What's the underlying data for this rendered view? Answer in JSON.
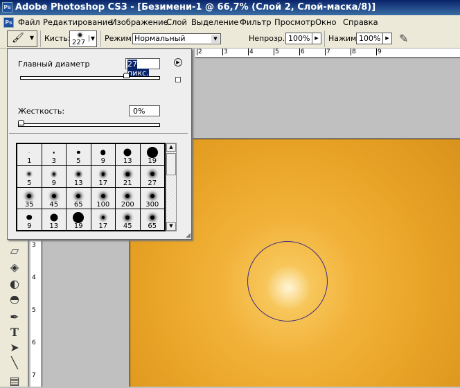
{
  "title": "Adobe Photoshop CS3 - [Безимени-1 @ 66,7% (Слой 2, Слой-маска/8)]",
  "menu": [
    "Файл",
    "Редактирование",
    "Изображение",
    "Слой",
    "Выделение",
    "Фильтр",
    "Просмотр",
    "Окно",
    "Справка"
  ],
  "options": {
    "brush_label": "Кисть:",
    "brush_size": "227",
    "mode_label": "Режим:",
    "mode_value": "Нормальный",
    "opacity_label": "Непрозр.:",
    "opacity_value": "100%",
    "flow_label": "Нажим:",
    "flow_value": "100%"
  },
  "ruler_top": [
    "2",
    "3",
    "4",
    "5",
    "6",
    "7",
    "8",
    "9"
  ],
  "ruler_left": [
    "3",
    "4",
    "5",
    "6",
    "7"
  ],
  "brush_panel": {
    "diameter_label": "Главный диаметр",
    "diameter_value": "27 пикс.",
    "diameter_fraction": 0.77,
    "hardness_label": "Жесткость:",
    "hardness_value": "0%",
    "hardness_fraction": 0,
    "presets": [
      {
        "size": "1",
        "hard": true
      },
      {
        "size": "3",
        "hard": true
      },
      {
        "size": "5",
        "hard": true
      },
      {
        "size": "9",
        "hard": true
      },
      {
        "size": "13",
        "hard": true
      },
      {
        "size": "19",
        "hard": true
      },
      {
        "size": "5",
        "hard": false
      },
      {
        "size": "9",
        "hard": false
      },
      {
        "size": "13",
        "hard": false
      },
      {
        "size": "17",
        "hard": false
      },
      {
        "size": "21",
        "hard": false
      },
      {
        "size": "27",
        "hard": false
      },
      {
        "size": "35",
        "hard": false
      },
      {
        "size": "45",
        "hard": false
      },
      {
        "size": "65",
        "hard": false
      },
      {
        "size": "100",
        "hard": false
      },
      {
        "size": "200",
        "hard": false
      },
      {
        "size": "300",
        "hard": false
      },
      {
        "size": "9",
        "hard": true
      },
      {
        "size": "13",
        "hard": true
      },
      {
        "size": "19",
        "hard": true
      },
      {
        "size": "17",
        "hard": false
      },
      {
        "size": "45",
        "hard": false
      },
      {
        "size": "65",
        "hard": false
      }
    ]
  }
}
